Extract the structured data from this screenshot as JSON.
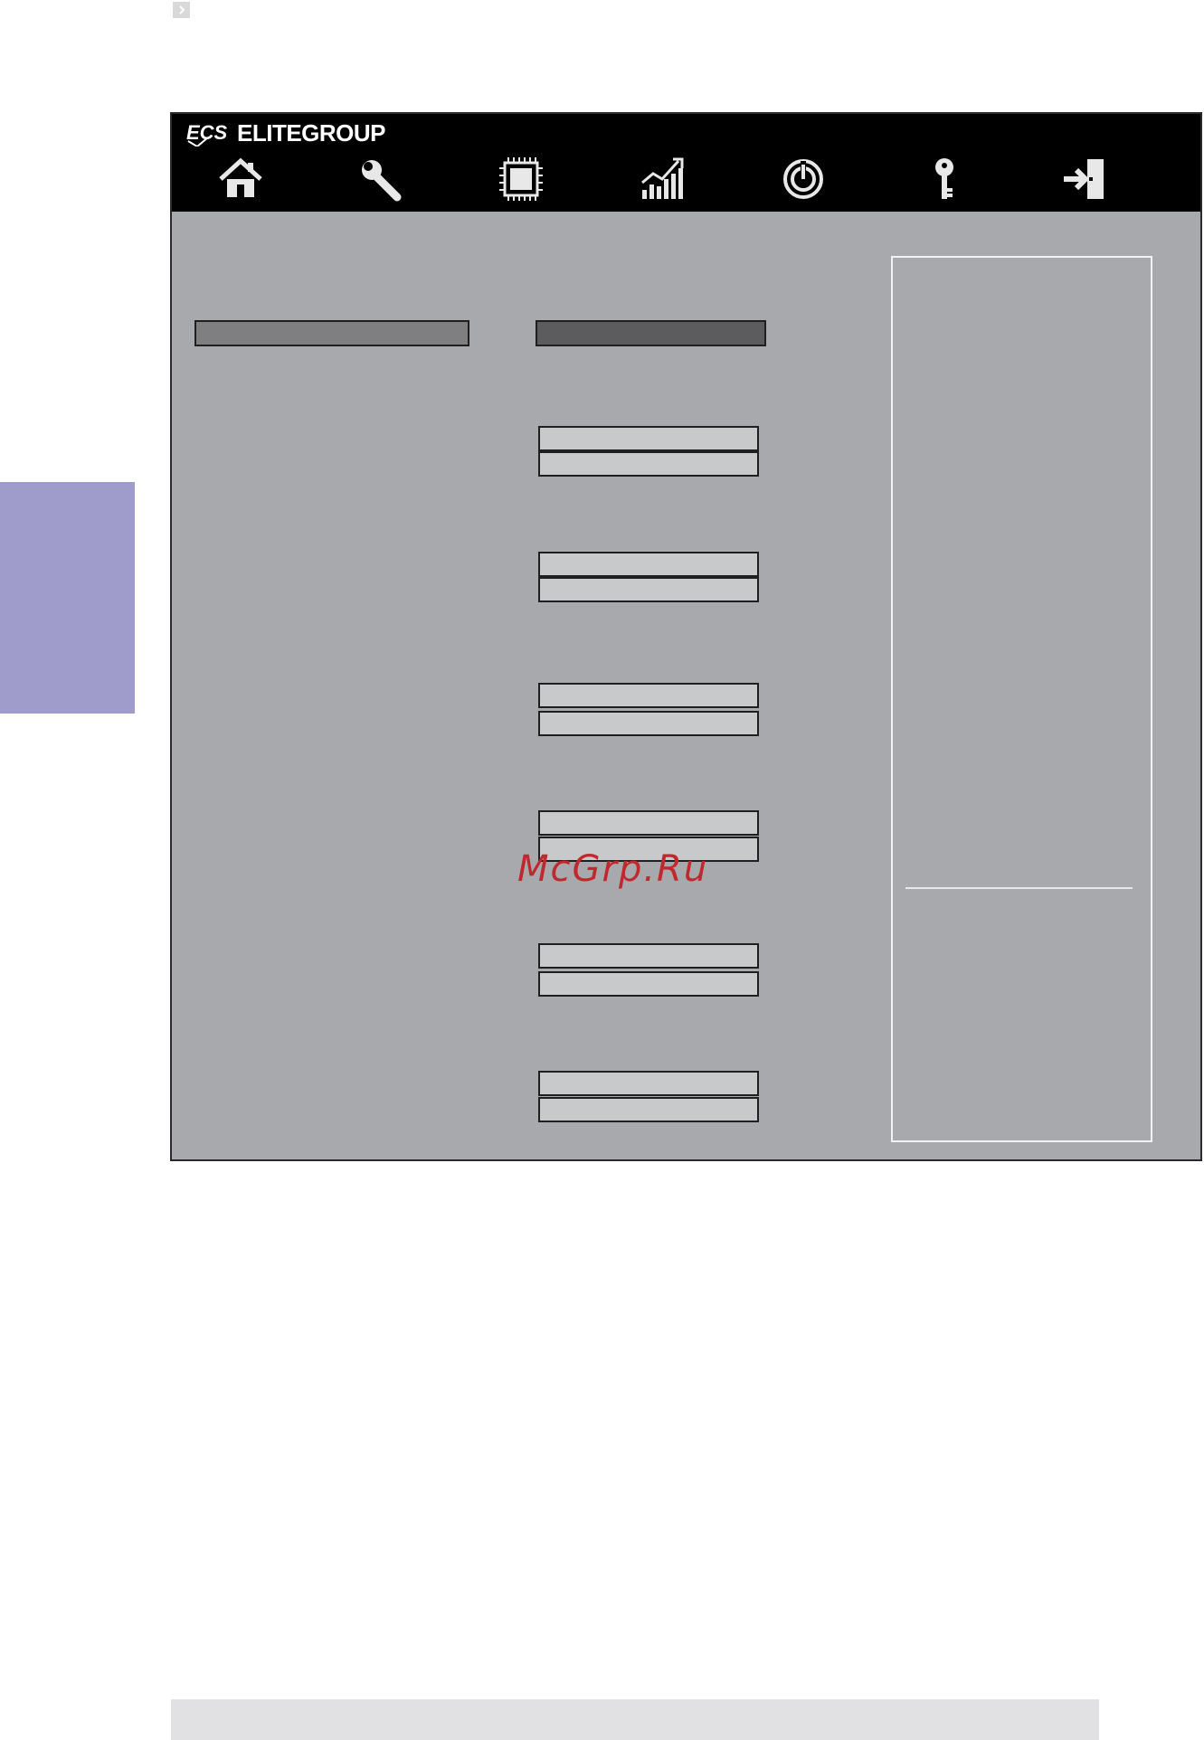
{
  "app": {
    "brand_name": "ELITEGROUP",
    "logo_text": "ECS"
  },
  "nav": {
    "icons": [
      "home-icon",
      "wrench-icon",
      "chip-icon",
      "chart-icon",
      "power-icon",
      "key-icon",
      "exit-icon"
    ]
  },
  "colors": {
    "topbar": "#000000",
    "panel_bg": "#a8a9ad",
    "side_tab": "#9f9bcb",
    "selected_left": "#7f7f82",
    "selected_right": "#5c5c5f",
    "option_field": "#c8c9cb",
    "watermark": "#c0282d"
  },
  "watermark": "McGrp.Ru"
}
